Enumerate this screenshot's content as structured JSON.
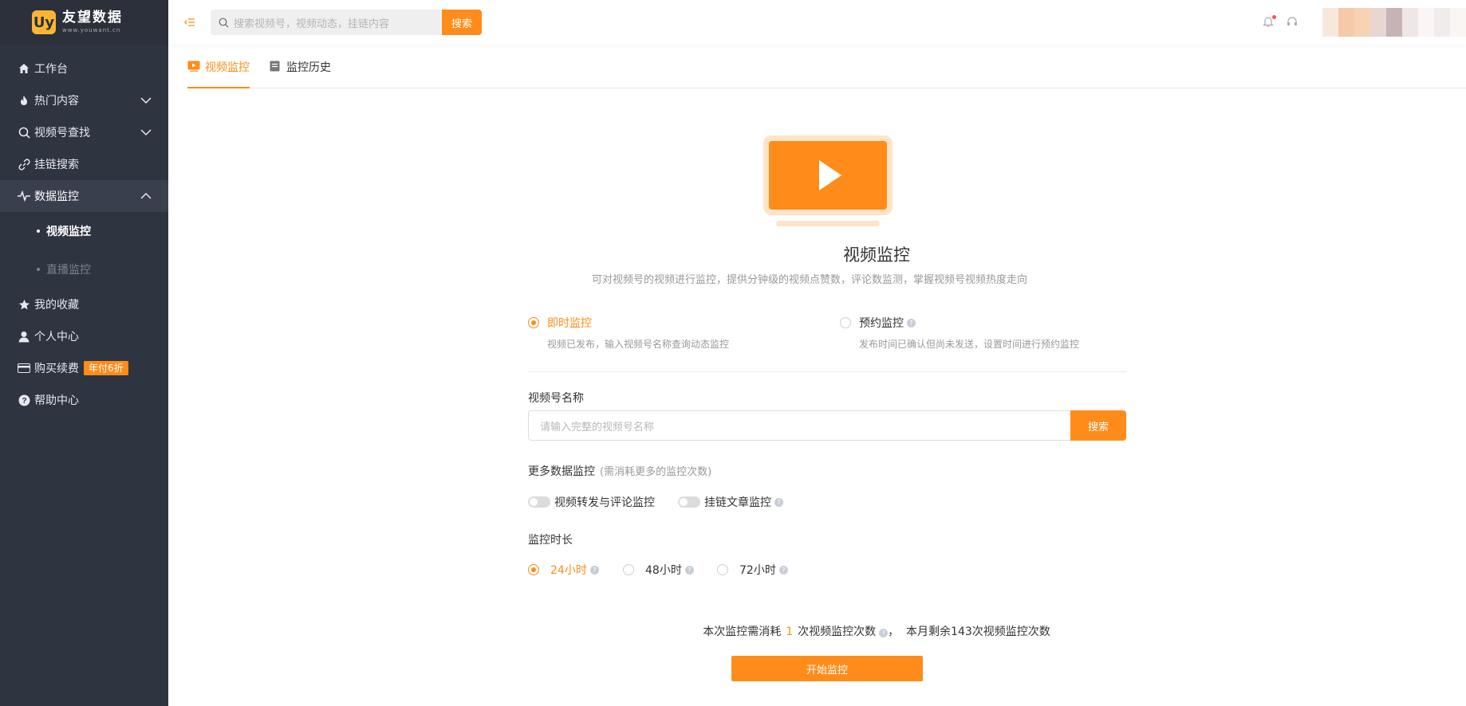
{
  "brand": {
    "logo_letter": "Uy",
    "name": "友望数据",
    "sub": "www.youwant.cn"
  },
  "sidebar": {
    "items": [
      {
        "label": "工作台",
        "icon": "home-icon"
      },
      {
        "label": "热门内容",
        "icon": "flame-icon"
      },
      {
        "label": "视频号查找",
        "icon": "search-icon"
      },
      {
        "label": "挂链搜索",
        "icon": "link-icon"
      },
      {
        "label": "数据监控",
        "icon": "pulse-icon"
      },
      {
        "label": "我的收藏",
        "icon": "star-icon"
      },
      {
        "label": "个人中心",
        "icon": "user-icon"
      },
      {
        "label": "购买续费",
        "icon": "card-icon",
        "badge": "年付6折"
      },
      {
        "label": "帮助中心",
        "icon": "help-icon"
      }
    ],
    "sub_items": [
      {
        "label": "视频监控",
        "active": true
      },
      {
        "label": "直播监控",
        "active": false
      }
    ]
  },
  "topbar": {
    "search_placeholder": "搜索视频号，视频动态，挂链内容",
    "search_button": "搜索"
  },
  "tabs": [
    {
      "label": "视频监控",
      "active": true
    },
    {
      "label": "监控历史",
      "active": false
    }
  ],
  "main": {
    "title": "视频监控",
    "description": "可对视频号的视频进行监控，提供分钟级的视频点赞数，评论数监测，掌握视频号视频热度走向",
    "modes": [
      {
        "label": "即时监控",
        "desc": "视频已发布，输入视频号名称查询动态监控",
        "selected": true
      },
      {
        "label": "预约监控",
        "desc": "发布时间已确认但尚未发送，设置时间进行预约监控",
        "selected": false
      }
    ],
    "channel_label": "视频号名称",
    "channel_placeholder": "请输入完整的视频号名称",
    "channel_search_button": "搜索",
    "more_label": "更多数据监控",
    "more_hint": "(需消耗更多的监控次数)",
    "toggles": [
      {
        "label": "视频转发与评论监控",
        "on": false
      },
      {
        "label": "挂链文章监控",
        "on": false
      }
    ],
    "duration_label": "监控时长",
    "durations": [
      {
        "label": "24小时",
        "selected": true
      },
      {
        "label": "48小时",
        "selected": false
      },
      {
        "label": "72小时",
        "selected": false
      }
    ],
    "cost_prefix": "本次监控需消耗",
    "cost_count": "1",
    "cost_unit": "次视频监控次数",
    "cost_separator": "，",
    "remaining_text": "本月剩余143次视频监控次数",
    "start_button": "开始监控"
  },
  "colors": {
    "accent": "#ff8c1a",
    "sidebar_bg": "#2f3441",
    "badge": "#ff8c1a"
  }
}
